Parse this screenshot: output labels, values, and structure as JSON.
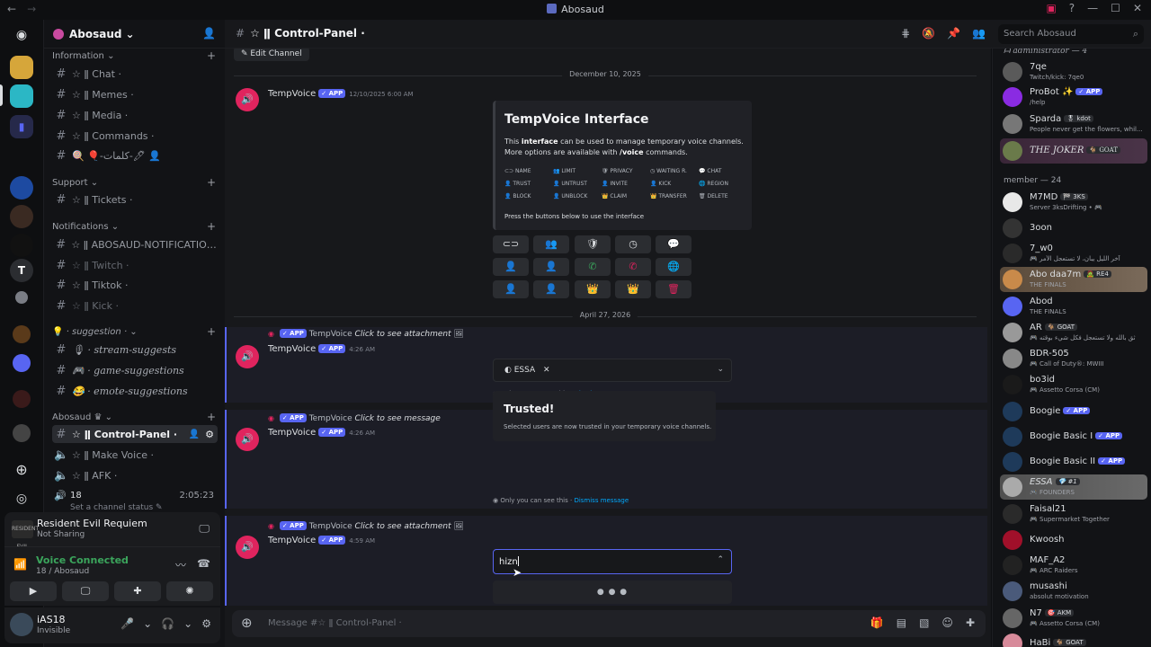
{
  "window": {
    "title": "Abosaud"
  },
  "server": {
    "name": "Abosaud"
  },
  "sidebar": {
    "categories": [
      {
        "name": "Information"
      },
      {
        "name": "Support"
      },
      {
        "name": "Notifications"
      },
      {
        "name": "· suggestion ·"
      },
      {
        "name": "Abosaud ♛"
      }
    ],
    "channels": {
      "chat": "☆ ǁ Chat ·",
      "memes": "☆ ǁ Memes ·",
      "media": "☆ ǁ Media ·",
      "commands": "☆ ǁ Commands ·",
      "misc": "🍭 🎈-كلمات-🖊 👤",
      "tickets": "☆ ǁ Tickets ·",
      "notif": "☆ ǁ ABOSAUD-NOTIFICATION...",
      "twitch": "☆ ǁ Twitch ·",
      "tiktok": "☆ ǁ Tiktok ·",
      "kick": "☆ ǁ Kick ·",
      "stream": "🎙 · stream-suggests",
      "game": "🎮 · game-suggestions",
      "emote": "😂 · emote-suggestions",
      "control": "☆ ǁ Control-Panel ·",
      "makevoice": "☆ ǁ Make Voice ·",
      "afk": "☆ ǁ AFK ·",
      "voice18": "18"
    },
    "voice_timer": "2:05:23",
    "set_status": "Set a channel status ✎"
  },
  "activity": {
    "game": "Resident Evil Requiem",
    "status": "Not Sharing",
    "thumb": "RESIDENT EVIL"
  },
  "voice": {
    "status": "Voice Connected",
    "location": "18 / Abosaud"
  },
  "user": {
    "name": "iAS18",
    "status": "Invisible"
  },
  "header": {
    "channel": "☆ ǁ Control-Panel ·",
    "search_placeholder": "Search Abosaud"
  },
  "chat": {
    "edit_channel": "✎ Edit Channel",
    "date1": "December 10, 2025",
    "date2": "April 27, 2026",
    "bot_name": "TempVoice",
    "app_badge": "✓ APP",
    "msg1_time": "12/10/2025 6:00 AM",
    "embed_title": "TempVoice Interface",
    "embed_line1a": "This ",
    "embed_line1b": "interface",
    "embed_line1c": " can be used to manage temporary voice channels.",
    "embed_line2a": "More options are available with ",
    "embed_line2b": "/voice",
    "embed_line2c": " commands.",
    "embed_grid": [
      "⊂⊃ NAME",
      "👥 LIMIT",
      "🛡 PRIVACY",
      "◷ WAITING R.",
      "💬 CHAT",
      "👤 TRUST",
      "👤 UNTRUST",
      "👤 INVITE",
      "👤 KICK",
      "🌐 REGION",
      "👤 BLOCK",
      "👤 UNBLOCK",
      "👑 CLAIM",
      "👑 TRANSFER",
      "🗑 DELETE"
    ],
    "embed_footer": "Press the buttons below to use the interface",
    "buttons": [
      "⊂⊃",
      "👥",
      "🛡",
      "◷",
      "💬",
      "👤",
      "👤",
      "✆",
      "✆",
      "🌐",
      "👤",
      "👤",
      "👑",
      "👑",
      "🗑"
    ],
    "reply1": "Click to see attachment",
    "msg2_time": "4:26 AM",
    "select_chip": "ESSA",
    "only_you": "Only you can see this · ",
    "dismiss": "Dismiss message",
    "reply2": "Click to see message",
    "msg3_time": "4:26 AM",
    "trusted_title": "Trusted!",
    "trusted_desc": "Selected users are now trusted in your temporary voice channels.",
    "reply3": "Click to see attachment",
    "msg4_time": "4:59 AM",
    "input_value": "hizn",
    "loading": "● ● ●",
    "composer_placeholder": "Message #☆ ǁ Control-Panel ·"
  },
  "members": {
    "admin_header": "ᗩ administrator — 4",
    "member_header": "member — 24",
    "list": [
      {
        "name": "7qe",
        "sub": "Twitch/kick: 7qe0"
      },
      {
        "name": "ProBot ✨",
        "tag": "✓ APP",
        "sub": "/help"
      },
      {
        "name": "Sparda",
        "tag": "🎖 kdot",
        "sub": "People never get the flowers, whil..."
      },
      {
        "name": "THE JOKER",
        "tag": "🐐 GOAT",
        "sub": ""
      },
      {
        "name": "M7MD",
        "tag": "🏁 3KS",
        "sub": "Server 3ksDrifting • 🎮"
      },
      {
        "name": "3oon",
        "sub": ""
      },
      {
        "name": "7_w0",
        "sub": "🎮 آخر الليل يبان، لا تستعجل الأمر"
      },
      {
        "name": "Abo daa7m",
        "tag": "🧟 RE4",
        "sub": "THE FINALS"
      },
      {
        "name": "Abod",
        "sub": "THE FINALS"
      },
      {
        "name": "AR",
        "tag": "🐐 GOAT",
        "sub": "🎮 ثق بالله ولا تستعجل فكل شيء بوقته"
      },
      {
        "name": "BDR-505",
        "sub": "🎮 Call of Duty®: MWIII"
      },
      {
        "name": "bo3id",
        "sub": "🎮 Assetto Corsa (CM)"
      },
      {
        "name": "Boogie",
        "tag": "✓ APP",
        "sub": ""
      },
      {
        "name": "Boogie Basic I",
        "tag": "✓ APP",
        "sub": ""
      },
      {
        "name": "Boogie Basic II",
        "tag": "✓ APP",
        "sub": ""
      },
      {
        "name": "ESSA",
        "tag": "💎 #1",
        "sub": "🎮 FOUNDERS"
      },
      {
        "name": "Faisal21",
        "sub": "🎮 Supermarket Together"
      },
      {
        "name": "Kwoosh",
        "sub": ""
      },
      {
        "name": "MAF_A2",
        "sub": "🎮 ARC Raiders"
      },
      {
        "name": "musashi",
        "sub": "absolut motivation"
      },
      {
        "name": "N7",
        "tag": "🎯 AKM",
        "sub": "🎮 Assetto Corsa (CM)"
      },
      {
        "name": "HaBi",
        "tag": "🐐 GOAT",
        "sub": ""
      }
    ]
  },
  "colors": {
    "accent": "#5865f2",
    "bot": "#e0245e",
    "green": "#3ba55c"
  }
}
